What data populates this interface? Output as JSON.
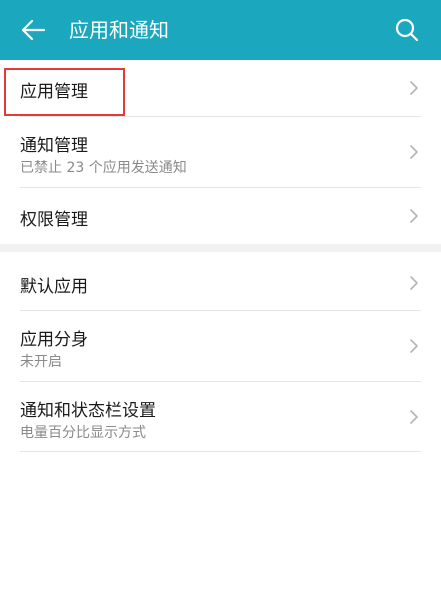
{
  "header": {
    "title": "应用和通知",
    "back_icon": "arrow-left-icon",
    "search_icon": "search-icon",
    "bg_color": "#1ba7bd"
  },
  "menu": [
    {
      "label": "应用管理",
      "subtitle": ""
    },
    {
      "label": "通知管理",
      "subtitle": "已禁止 23 个应用发送通知"
    },
    {
      "label": "权限管理",
      "subtitle": ""
    },
    {
      "label": "默认应用",
      "subtitle": ""
    },
    {
      "label": "应用分身",
      "subtitle": "未开启"
    },
    {
      "label": "通知和状态栏设置",
      "subtitle": "电量百分比显示方式"
    }
  ],
  "highlight_color": "#e53935"
}
